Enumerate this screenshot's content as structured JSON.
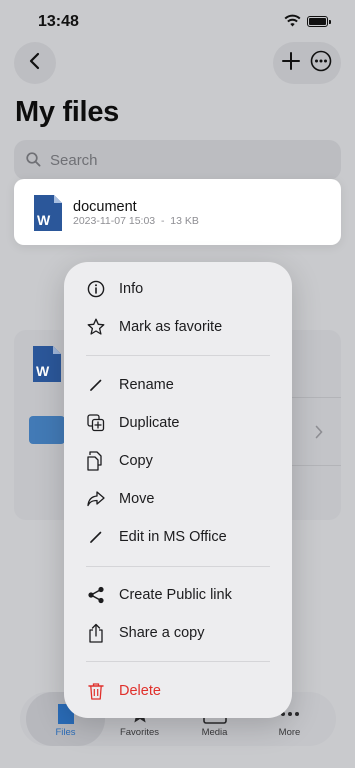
{
  "status": {
    "time": "13:48"
  },
  "header": {
    "title": "My files"
  },
  "search": {
    "placeholder": "Search"
  },
  "selected_file": {
    "name": "document",
    "meta": "2023-11-07 15:03  -  13 KB",
    "type_letter": "W"
  },
  "context_menu": {
    "items": [
      {
        "label": "Info",
        "icon": "info-icon"
      },
      {
        "label": "Mark as favorite",
        "icon": "star-icon"
      },
      {
        "label": "Rename",
        "icon": "pencil-icon"
      },
      {
        "label": "Duplicate",
        "icon": "duplicate-icon"
      },
      {
        "label": "Copy",
        "icon": "copy-icon"
      },
      {
        "label": "Move",
        "icon": "share-arrow-icon"
      },
      {
        "label": "Edit in MS Office",
        "icon": "pencil-icon"
      },
      {
        "label": "Create Public link",
        "icon": "share-nodes-icon"
      },
      {
        "label": "Share a copy",
        "icon": "share-box-icon"
      },
      {
        "label": "Delete",
        "icon": "trash-icon",
        "color": "#e0302b"
      }
    ]
  },
  "tabbar": {
    "tabs": [
      {
        "label": "Files",
        "icon": "file-icon",
        "active": true
      },
      {
        "label": "Favorites",
        "icon": "star-icon"
      },
      {
        "label": "Media",
        "icon": "media-icon"
      },
      {
        "label": "More",
        "icon": "ellipsis-icon"
      }
    ]
  },
  "colors": {
    "accent": "#2a6cb8",
    "danger": "#e0302b",
    "word_blue": "#2b579a"
  }
}
